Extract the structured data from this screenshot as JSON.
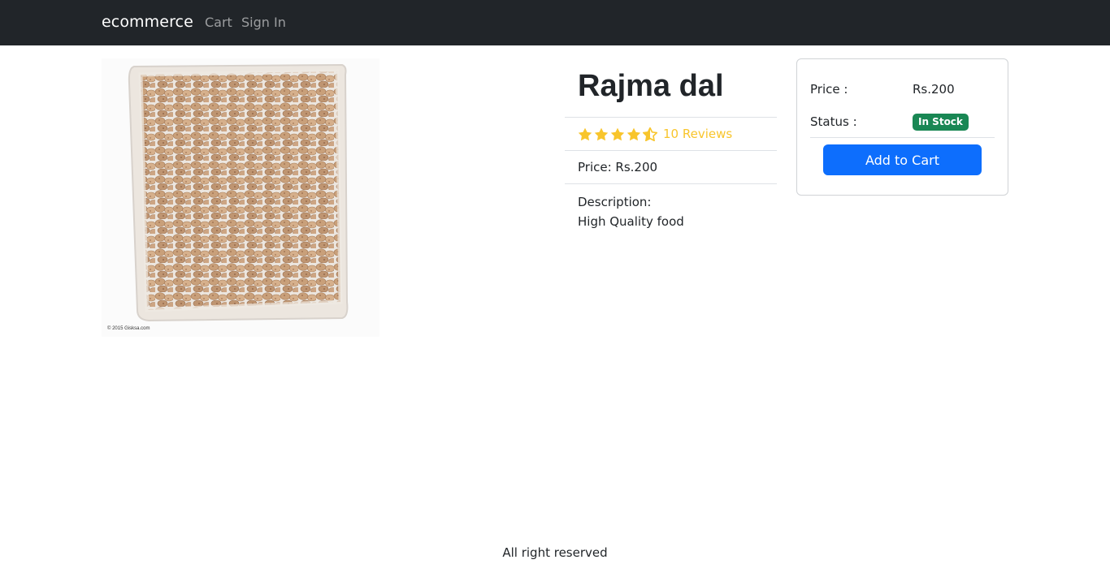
{
  "navbar": {
    "brand": "ecommerce",
    "links": [
      {
        "label": "Cart"
      },
      {
        "label": "Sign In"
      }
    ]
  },
  "product": {
    "name": "Rajma dal",
    "image_caption": "© 2015 Gisksa.com",
    "rating": 4.5,
    "reviews_text": "10 Reviews",
    "price_text": "Price: Rs.200",
    "description_label": "Description:",
    "description": "High Quality food"
  },
  "purchase_card": {
    "price_label": "Price :",
    "price_value": "Rs.200",
    "status_label": "Status :",
    "status_badge": "In Stock",
    "add_to_cart_label": "Add to Cart"
  },
  "footer": {
    "text": "All right reserved"
  },
  "colors": {
    "navbar_bg": "#212529",
    "star": "#f8c52c",
    "badge_success": "#198754",
    "primary_button": "#0d6efd"
  }
}
